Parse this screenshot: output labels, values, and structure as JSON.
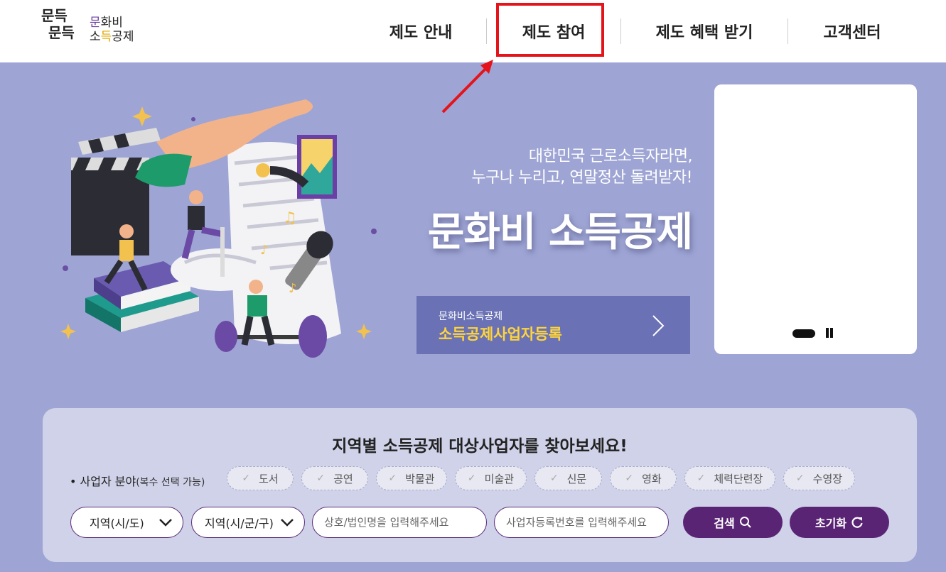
{
  "header": {
    "logo_mark_line1": "문득",
    "logo_mark_line2": "문득",
    "logo_sub_p1": "문",
    "logo_sub_p2": "화비",
    "logo_sub_p3": "소",
    "logo_sub_p4": "득",
    "logo_sub_p5": "공제",
    "nav": [
      "제도 안내",
      "제도 참여",
      "제도 혜택 받기",
      "고객센터"
    ]
  },
  "hero": {
    "subtitle_line1": "대한민국 근로소득자라면,",
    "subtitle_line2": "누구나 누리고, 연말정산 돌려받자!",
    "title": "문화비 소득공제",
    "register_small": "문화비소득공제",
    "register_big": "소득공제사업자등록"
  },
  "search": {
    "title": "지역별 소득공제 대상사업자를 찾아보세요!",
    "category_label": "• 사업자 분야",
    "category_note": "(복수 선택 가능)",
    "categories": [
      "도서",
      "공연",
      "박물관",
      "미술관",
      "신문",
      "영화",
      "체력단련장",
      "수영장"
    ],
    "region_select": "지역(시/도)",
    "district_select": "지역(시/군/구)",
    "name_placeholder": "상호/법인명을 입력해주세요",
    "bizno_placeholder": "사업자등록번호를 입력해주세요",
    "search_button": "검색",
    "reset_button": "초기화"
  },
  "colors": {
    "hero_bg": "#9ea5d4",
    "accent_purple": "#5a2474",
    "register_btn": "#6a72b5",
    "register_text": "#ffd43b",
    "highlight_red": "#e5141b"
  }
}
